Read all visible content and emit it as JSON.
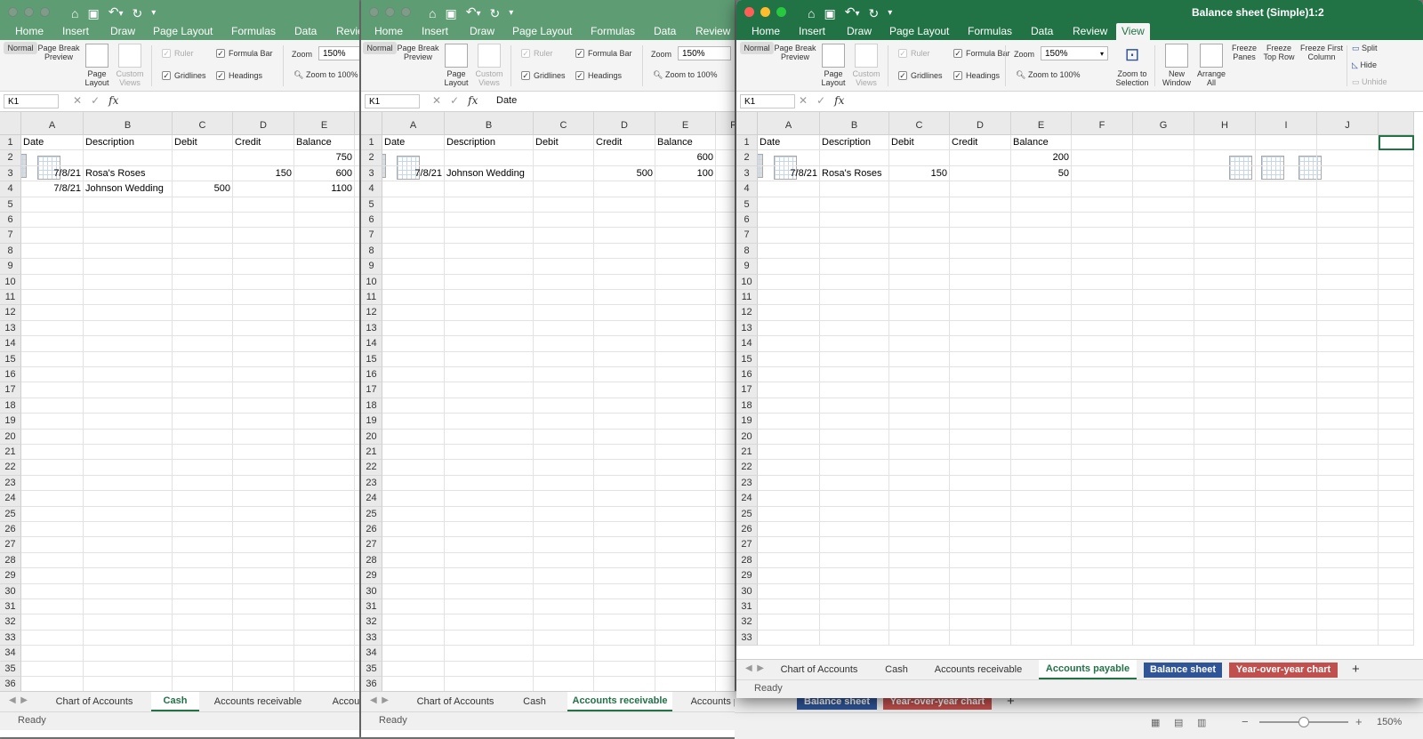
{
  "ribbon_tabs": [
    "Home",
    "Insert",
    "Draw",
    "Page Layout",
    "Formulas",
    "Data",
    "Review",
    "View"
  ],
  "view_buttons": {
    "normal": "Normal",
    "page_break": "Page Break Preview",
    "page_layout": "Page Layout",
    "custom_views": "Custom Views",
    "ruler": "Ruler",
    "formula_bar": "Formula Bar",
    "gridlines": "Gridlines",
    "headings": "Headings",
    "zoom_label": "Zoom",
    "zoom_value": "150%",
    "zoom_100": "Zoom to 100%",
    "zoom_selection": "Zoom to Selection",
    "new_window": "New Window",
    "arrange_all": "Arrange All",
    "freeze_panes": "Freeze Panes",
    "freeze_top_row": "Freeze Top Row",
    "freeze_first_col": "Freeze First Column",
    "split": "Split",
    "hide": "Hide",
    "unhide": "Unhide"
  },
  "columns": [
    "A",
    "B",
    "C",
    "D",
    "E",
    "F",
    "G",
    "H",
    "I",
    "J"
  ],
  "sheet_tabs": {
    "chart": "Chart of Accounts",
    "cash": "Cash",
    "ar": "Accounts receivable",
    "ap": "Accounts payable",
    "ap_trunc": "Accoun",
    "bs": "Balance sheet",
    "yoy": "Year-over-year chart",
    "plus": "+"
  },
  "status": "Ready",
  "status_zoom": "150%",
  "window1": {
    "name_box": "K1",
    "formula": "",
    "headers": [
      "Date",
      "Description",
      "Debit",
      "Credit",
      "Balance"
    ],
    "rows": [
      {
        "balance": "750"
      },
      {
        "date": "7/8/21",
        "desc": "Rosa's Roses",
        "credit": "150",
        "balance": "600"
      },
      {
        "date": "7/8/21",
        "desc": "Johnson Wedding",
        "debit": "500",
        "balance": "1100"
      }
    ]
  },
  "window2": {
    "name_box": "K1",
    "formula": "Date",
    "headers": [
      "Date",
      "Description",
      "Debit",
      "Credit",
      "Balance"
    ],
    "rows": [
      {
        "balance": "600"
      },
      {
        "date": "7/8/21",
        "desc": "Johnson Wedding",
        "credit": "500",
        "balance": "100"
      }
    ]
  },
  "window3": {
    "title": "Balance sheet (Simple)1:2",
    "name_box": "K1",
    "formula": "",
    "headers": [
      "Date",
      "Description",
      "Debit",
      "Credit",
      "Balance"
    ],
    "rows": [
      {
        "balance": "200"
      },
      {
        "date": "7/8/21",
        "desc": "Rosa's Roses",
        "debit": "150",
        "balance": "50"
      }
    ]
  },
  "colors": {
    "excel_green": "#217346",
    "tab_blue": "#2f5597",
    "tab_red": "#c0504d"
  }
}
